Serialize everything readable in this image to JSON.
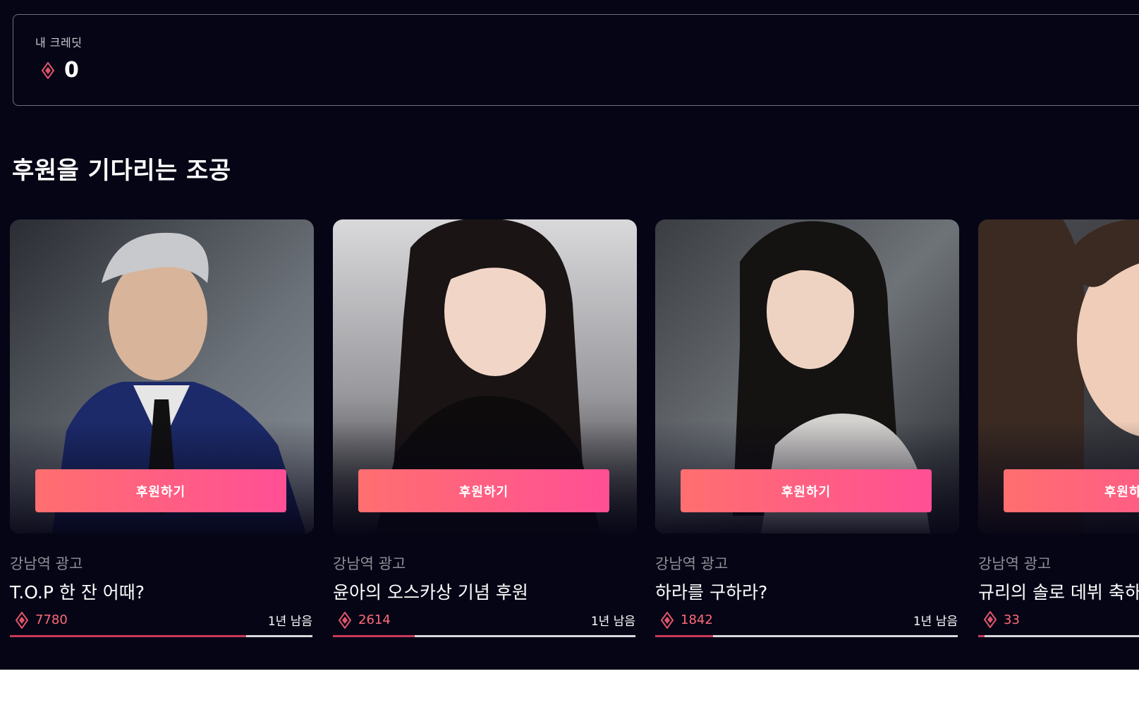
{
  "credit": {
    "label": "내 크레딧",
    "value": "0"
  },
  "section": {
    "title": "후원을 기다리는 조공"
  },
  "cards": [
    {
      "category": "강남역 광고",
      "title": "T.O.P 한 잔 어때?",
      "amount": "7780",
      "remaining": "1년 남음",
      "button_label": "후원하기",
      "progress": 0.78
    },
    {
      "category": "강남역 광고",
      "title": "윤아의 오스카상 기념 후원",
      "amount": "2614",
      "remaining": "1년 남음",
      "button_label": "후원하기",
      "progress": 0.27
    },
    {
      "category": "강남역 광고",
      "title": "하라를 구하라?",
      "amount": "1842",
      "remaining": "1년 남음",
      "button_label": "후원하기",
      "progress": 0.19
    },
    {
      "category": "강남역 광고",
      "title": "규리의 솔로 데뷔 축하",
      "amount": "33",
      "remaining": "",
      "button_label": "후원하기",
      "progress": 0.02
    }
  ],
  "colors": {
    "background": "#060516",
    "accent": "#ff5a7e",
    "amount": "#ff6a78",
    "progress_fill": "#c93a5a",
    "progress_track": "#d8d8dc"
  },
  "icons": {
    "credit": "diamond-gem-icon",
    "amount": "diamond-gem-icon"
  }
}
